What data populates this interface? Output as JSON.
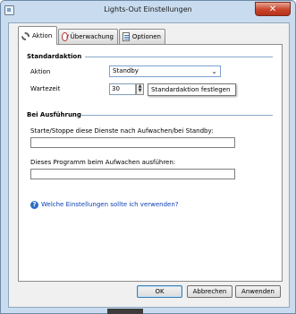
{
  "window": {
    "title": "Lights-Out Einstellungen",
    "close_glyph": "✕"
  },
  "tabs": [
    {
      "label": "Aktion",
      "icon": "gear-icon",
      "active": true
    },
    {
      "label": "Überwachung",
      "icon": "gauge-icon",
      "active": false
    },
    {
      "label": "Optionen",
      "icon": "list-icon",
      "active": false
    }
  ],
  "standard_section": {
    "title": "Standardaktion",
    "aktion_label": "Aktion",
    "aktion_value": "Standby",
    "wartezeit_label": "Wartezeit",
    "wartezeit_value": "30",
    "tooltip": "Standardaktion festlegen"
  },
  "execution_section": {
    "title": "Bei Ausführung",
    "services_label": "Starte/Stoppe diese Dienste nach Aufwachen/bei Standby:",
    "services_value": "",
    "program_label": "Dieses Programm beim Aufwachen ausführen:",
    "program_value": ""
  },
  "help_link": "Welche Einstellungen sollte ich verwenden?",
  "buttons": {
    "ok": "OK",
    "cancel": "Abbrechen",
    "apply": "Anwenden"
  },
  "colors": {
    "frame": "#c9dcef",
    "close": "#c9442b",
    "section_line": "#8aa8cc",
    "link": "#0b3fb4"
  }
}
